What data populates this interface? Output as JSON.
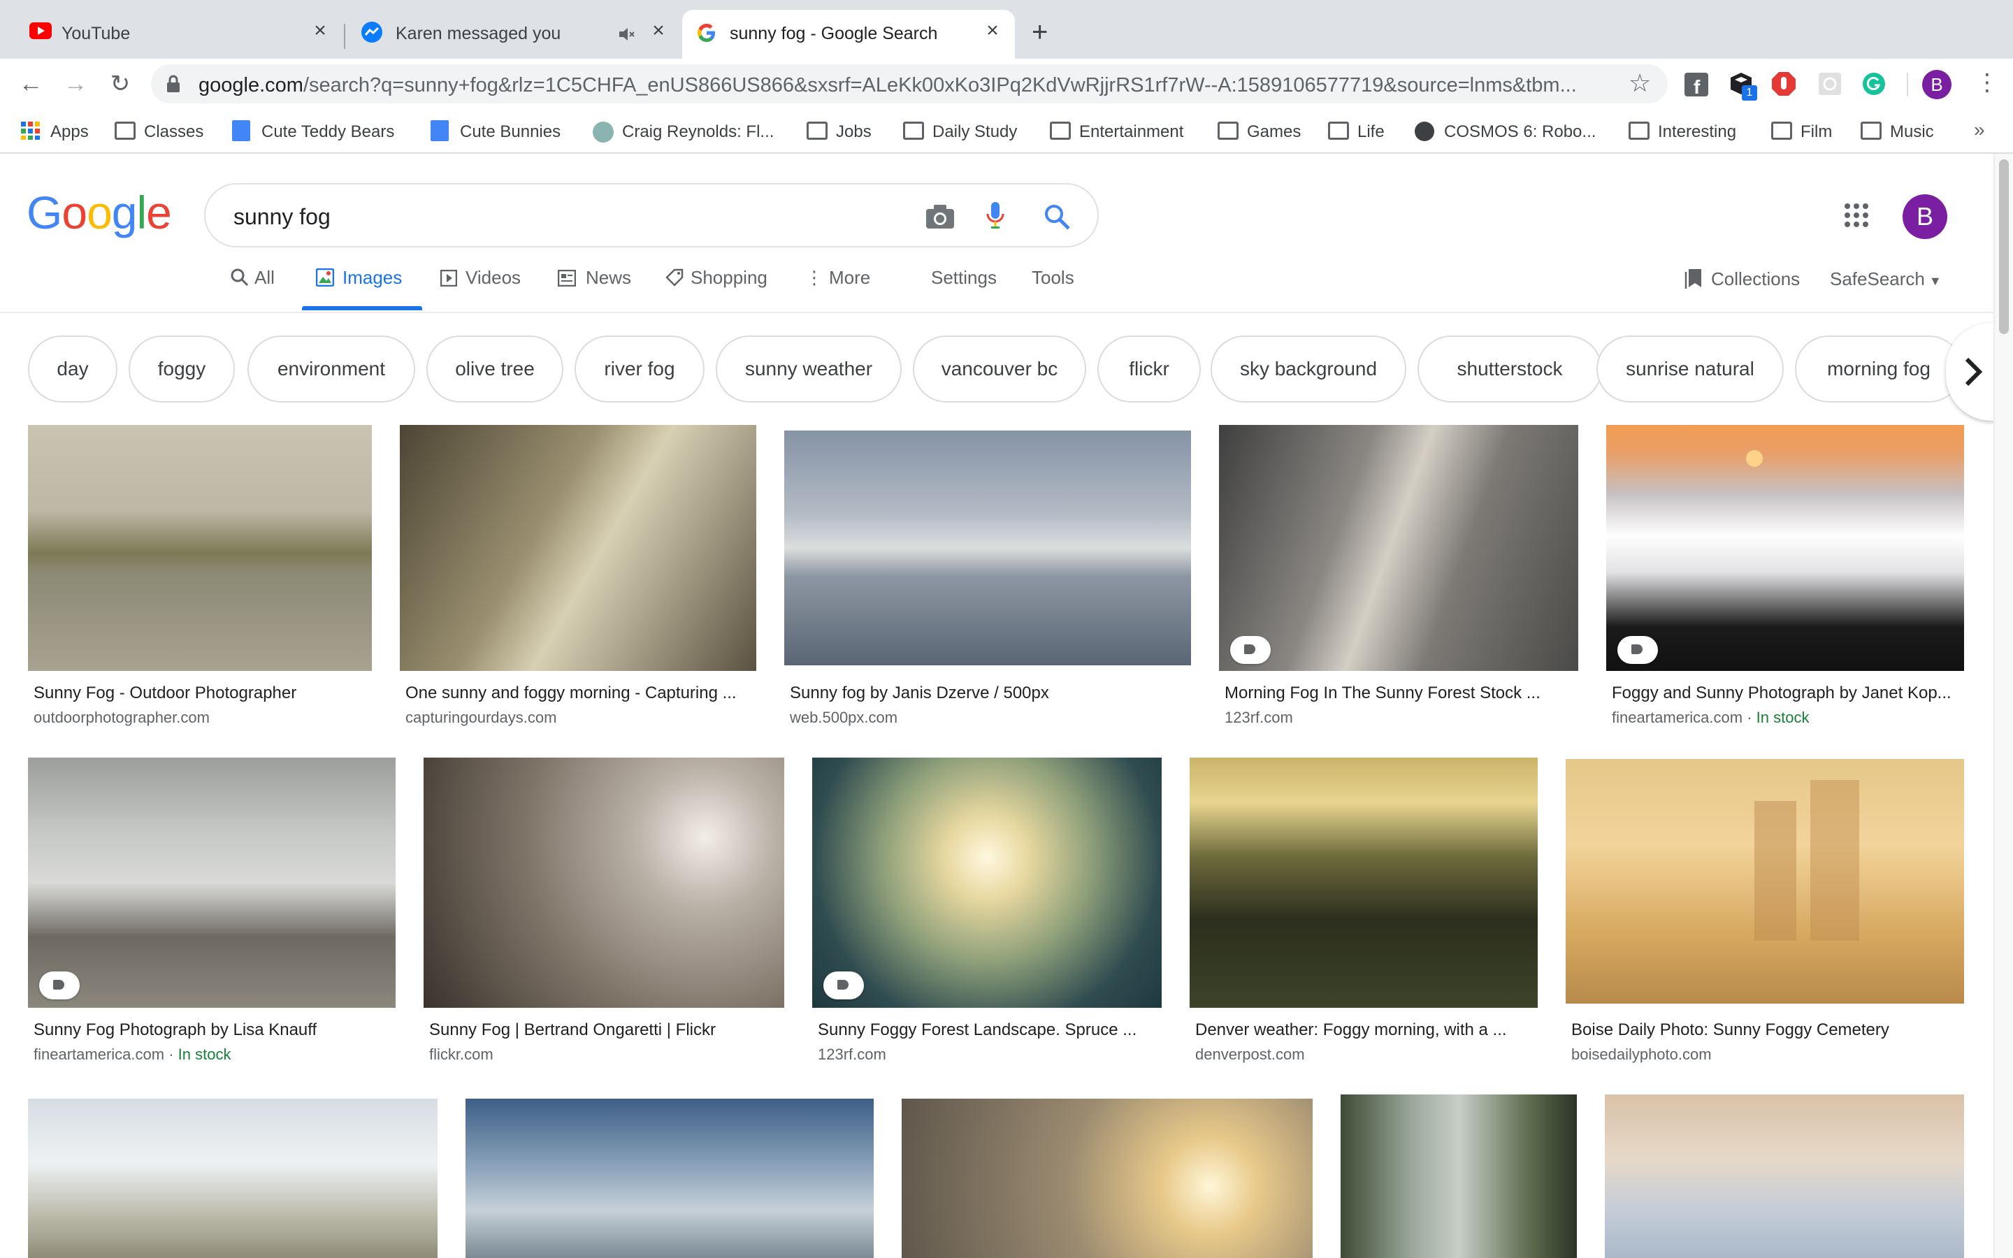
{
  "browser": {
    "tabs": [
      {
        "title": "YouTube",
        "icon": "youtube-icon"
      },
      {
        "title": "Karen messaged you",
        "icon": "messenger-icon",
        "muted": true
      },
      {
        "title": "sunny fog - Google Search",
        "icon": "google-icon",
        "active": true
      }
    ],
    "new_tab": "+",
    "url_domain": "google.com",
    "url_rest": "/search?q=sunny+fog&rlz=1C5CHFA_enUS866US866&sxsrf=ALeKk00xKo3IPq2KdVwRjjrRS1rf7rW--A:1589106577719&source=lnms&tbm...",
    "extension_badge": "1",
    "profile_letter": "B"
  },
  "bookmarks": [
    {
      "label": "Apps",
      "icon": "apps-grid-icon"
    },
    {
      "label": "Classes",
      "icon": "folder-icon"
    },
    {
      "label": "Cute Teddy Bears",
      "icon": "docs-icon"
    },
    {
      "label": "Cute Bunnies",
      "icon": "docs-icon"
    },
    {
      "label": "Craig Reynolds: Fl...",
      "icon": "site-icon"
    },
    {
      "label": "Jobs",
      "icon": "folder-icon"
    },
    {
      "label": "Daily Study",
      "icon": "folder-icon"
    },
    {
      "label": "Entertainment",
      "icon": "folder-icon"
    },
    {
      "label": "Games",
      "icon": "folder-icon"
    },
    {
      "label": "Life",
      "icon": "folder-icon"
    },
    {
      "label": "COSMOS 6: Robo...",
      "icon": "globe-icon"
    },
    {
      "label": "Interesting",
      "icon": "folder-icon"
    },
    {
      "label": "Film",
      "icon": "folder-icon"
    },
    {
      "label": "Music",
      "icon": "folder-icon"
    }
  ],
  "bookmarks_overflow": "»",
  "search": {
    "query": "sunny fog",
    "profile_letter": "B",
    "nav": [
      {
        "label": "All",
        "icon": "search-icon"
      },
      {
        "label": "Images",
        "icon": "image-icon",
        "active": true
      },
      {
        "label": "Videos",
        "icon": "video-icon"
      },
      {
        "label": "News",
        "icon": "news-icon"
      },
      {
        "label": "Shopping",
        "icon": "tag-icon"
      },
      {
        "label": "More",
        "icon": "more-vert-icon"
      }
    ],
    "settings": "Settings",
    "tools": "Tools",
    "collections": "Collections",
    "safesearch": "SafeSearch"
  },
  "chips": [
    "day",
    "foggy",
    "environment",
    "olive tree",
    "river fog",
    "sunny weather",
    "vancouver bc",
    "flickr",
    "sky background",
    "shutterstock",
    "sunrise natural",
    "morning fog"
  ],
  "results_row1": [
    {
      "title": "Sunny Fog - Outdoor Photographer",
      "source": "outdoorphotographer.com"
    },
    {
      "title": "One sunny and foggy morning - Capturing ...",
      "source": "capturingourdays.com"
    },
    {
      "title": "Sunny fog by Janis Dzerve / 500px",
      "source": "web.500px.com"
    },
    {
      "title": "Morning Fog In The Sunny Forest Stock ...",
      "source": "123rf.com"
    },
    {
      "title": "Foggy and Sunny Photograph by Janet Kop...",
      "source": "fineartamerica.com",
      "stock": "In stock"
    }
  ],
  "results_row2": [
    {
      "title": "Sunny Fog Photograph by Lisa Knauff",
      "source": "fineartamerica.com",
      "stock": "In stock"
    },
    {
      "title": "Sunny Fog | Bertrand Ongaretti | Flickr",
      "source": "flickr.com"
    },
    {
      "title": "Sunny Foggy Forest Landscape. Spruce ...",
      "source": "123rf.com"
    },
    {
      "title": "Denver weather: Foggy morning, with a ...",
      "source": "denverpost.com"
    },
    {
      "title": "Boise Daily Photo: Sunny Foggy Cemetery",
      "source": "boisedailyphoto.com"
    }
  ],
  "stock_separator": " · ",
  "colors": {
    "google_blue": "#1a73e8",
    "stock_green": "#188038",
    "avatar_purple": "#7b1fa2"
  }
}
